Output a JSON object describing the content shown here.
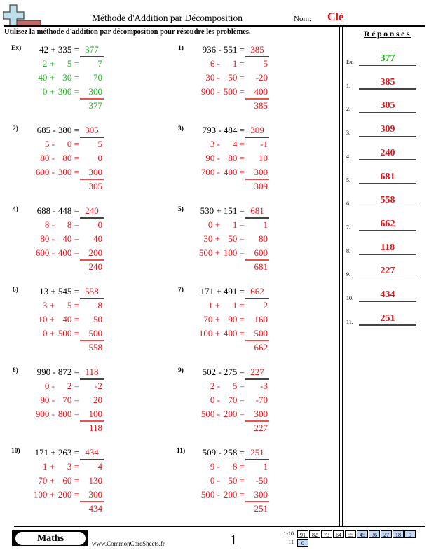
{
  "header": {
    "title": "Méthode d'Addition par Décomposition",
    "name_label": "Nom:",
    "name_value": "Clé",
    "instructions": "Utilisez la méthode d'addition par décomposition pour résoudre les problèmes.",
    "logo_icon": "plus-sign-logo-icon"
  },
  "colors": {
    "answer_red": "#e8141c",
    "example_green": "#22b022",
    "score_blue": "#c4d9f5"
  },
  "problems": [
    {
      "label": "Ex)",
      "expr": "42 + 335 =",
      "answer": "377",
      "color": "green",
      "steps": [
        {
          "a": "2 +",
          "b": "5 =",
          "r": "7"
        },
        {
          "a": "40 +",
          "b": "30 =",
          "r": "70"
        },
        {
          "a": "0 +",
          "b": "300 =",
          "r": "300"
        }
      ],
      "total": "377"
    },
    {
      "label": "1)",
      "expr": "936 - 551 =",
      "answer": "385",
      "color": "red",
      "steps": [
        {
          "a": "6 -",
          "b": "1 =",
          "r": "5"
        },
        {
          "a": "30 -",
          "b": "50 =",
          "r": "-20"
        },
        {
          "a": "900 -",
          "b": "500 =",
          "r": "400"
        }
      ],
      "total": "385"
    },
    {
      "label": "2)",
      "expr": "685 - 380 =",
      "answer": "305",
      "color": "red",
      "steps": [
        {
          "a": "5 -",
          "b": "0 =",
          "r": "5"
        },
        {
          "a": "80 -",
          "b": "80 =",
          "r": "0"
        },
        {
          "a": "600 -",
          "b": "300 =",
          "r": "300"
        }
      ],
      "total": "305"
    },
    {
      "label": "3)",
      "expr": "793 - 484 =",
      "answer": "309",
      "color": "red",
      "steps": [
        {
          "a": "3 -",
          "b": "4 =",
          "r": "-1"
        },
        {
          "a": "90 -",
          "b": "80 =",
          "r": "10"
        },
        {
          "a": "700 -",
          "b": "400 =",
          "r": "300"
        }
      ],
      "total": "309"
    },
    {
      "label": "4)",
      "expr": "688 - 448 =",
      "answer": "240",
      "color": "red",
      "steps": [
        {
          "a": "8 -",
          "b": "8 =",
          "r": "0"
        },
        {
          "a": "80 -",
          "b": "40 =",
          "r": "40"
        },
        {
          "a": "600 -",
          "b": "400 =",
          "r": "200"
        }
      ],
      "total": "240"
    },
    {
      "label": "5)",
      "expr": "530 + 151 =",
      "answer": "681",
      "color": "red",
      "steps": [
        {
          "a": "0 +",
          "b": "1 =",
          "r": "1"
        },
        {
          "a": "30 +",
          "b": "50 =",
          "r": "80"
        },
        {
          "a": "500 +",
          "b": "100 =",
          "r": "600"
        }
      ],
      "total": "681"
    },
    {
      "label": "6)",
      "expr": "13 + 545 =",
      "answer": "558",
      "color": "red",
      "steps": [
        {
          "a": "3 +",
          "b": "5 =",
          "r": "8"
        },
        {
          "a": "10 +",
          "b": "40 =",
          "r": "50"
        },
        {
          "a": "0 +",
          "b": "500 =",
          "r": "500"
        }
      ],
      "total": "558"
    },
    {
      "label": "7)",
      "expr": "171 + 491 =",
      "answer": "662",
      "color": "red",
      "steps": [
        {
          "a": "1 +",
          "b": "1 =",
          "r": "2"
        },
        {
          "a": "70 +",
          "b": "90 =",
          "r": "160"
        },
        {
          "a": "100 +",
          "b": "400 =",
          "r": "500"
        }
      ],
      "total": "662"
    },
    {
      "label": "8)",
      "expr": "990 - 872 =",
      "answer": "118",
      "color": "red",
      "steps": [
        {
          "a": "0 -",
          "b": "2 =",
          "r": "-2"
        },
        {
          "a": "90 -",
          "b": "70 =",
          "r": "20"
        },
        {
          "a": "900 -",
          "b": "800 =",
          "r": "100"
        }
      ],
      "total": "118"
    },
    {
      "label": "9)",
      "expr": "502 - 275 =",
      "answer": "227",
      "color": "red",
      "steps": [
        {
          "a": "2 -",
          "b": "5 =",
          "r": "-3"
        },
        {
          "a": "0 -",
          "b": "70 =",
          "r": "-70"
        },
        {
          "a": "500 -",
          "b": "200 =",
          "r": "300"
        }
      ],
      "total": "227"
    },
    {
      "label": "10)",
      "expr": "171 + 263 =",
      "answer": "434",
      "color": "red",
      "steps": [
        {
          "a": "1 +",
          "b": "3 =",
          "r": "4"
        },
        {
          "a": "70 +",
          "b": "60 =",
          "r": "130"
        },
        {
          "a": "100 +",
          "b": "200 =",
          "r": "300"
        }
      ],
      "total": "434"
    },
    {
      "label": "11)",
      "expr": "509 - 258 =",
      "answer": "251",
      "color": "red",
      "steps": [
        {
          "a": "9 -",
          "b": "8 =",
          "r": "1"
        },
        {
          "a": "0 -",
          "b": "50 =",
          "r": "-50"
        },
        {
          "a": "500 -",
          "b": "200 =",
          "r": "300"
        }
      ],
      "total": "251"
    }
  ],
  "answers": {
    "title": "Réponses",
    "items": [
      {
        "num": "Ex.",
        "value": "377",
        "color": "green"
      },
      {
        "num": "1.",
        "value": "385",
        "color": "red"
      },
      {
        "num": "2.",
        "value": "305",
        "color": "red"
      },
      {
        "num": "3.",
        "value": "309",
        "color": "red"
      },
      {
        "num": "4.",
        "value": "240",
        "color": "red"
      },
      {
        "num": "5.",
        "value": "681",
        "color": "red"
      },
      {
        "num": "6.",
        "value": "558",
        "color": "red"
      },
      {
        "num": "7.",
        "value": "662",
        "color": "red"
      },
      {
        "num": "8.",
        "value": "118",
        "color": "red"
      },
      {
        "num": "9.",
        "value": "227",
        "color": "red"
      },
      {
        "num": "10.",
        "value": "434",
        "color": "red"
      },
      {
        "num": "11.",
        "value": "251",
        "color": "red"
      }
    ]
  },
  "footer": {
    "badge": "Maths",
    "site": "www.CommonCoreSheets.fr",
    "page": "1",
    "score_rows": [
      {
        "label": "1-10",
        "cells": [
          {
            "v": "91",
            "hl": false
          },
          {
            "v": "82",
            "hl": false
          },
          {
            "v": "73",
            "hl": false
          },
          {
            "v": "64",
            "hl": false
          },
          {
            "v": "55",
            "hl": false
          },
          {
            "v": "45",
            "hl": true
          },
          {
            "v": "36",
            "hl": true
          },
          {
            "v": "27",
            "hl": true
          },
          {
            "v": "18",
            "hl": true
          },
          {
            "v": "9",
            "hl": true
          }
        ]
      },
      {
        "label": "11",
        "cells": [
          {
            "v": "0",
            "hl": true
          }
        ]
      }
    ]
  }
}
